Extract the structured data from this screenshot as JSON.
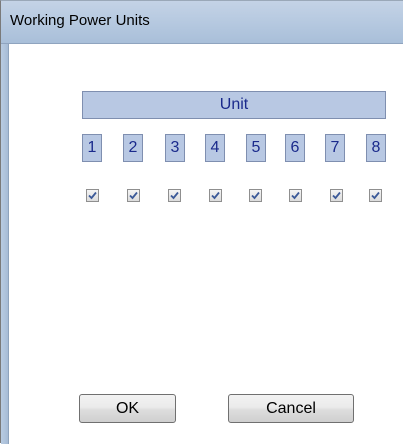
{
  "window": {
    "title": "Working Power Units"
  },
  "unit_header": {
    "label": "Unit"
  },
  "units": [
    {
      "number": "1",
      "checked": true
    },
    {
      "number": "2",
      "checked": true
    },
    {
      "number": "3",
      "checked": true
    },
    {
      "number": "4",
      "checked": true
    },
    {
      "number": "5",
      "checked": true
    },
    {
      "number": "6",
      "checked": true
    },
    {
      "number": "7",
      "checked": true
    },
    {
      "number": "8",
      "checked": true
    }
  ],
  "buttons": {
    "ok_label": "OK",
    "cancel_label": "Cancel"
  },
  "colors": {
    "header_bg": "#b8c8e3",
    "header_text": "#1a2a8c",
    "titlebar": "#b6c9e0",
    "check_mark": "#3b5998"
  }
}
